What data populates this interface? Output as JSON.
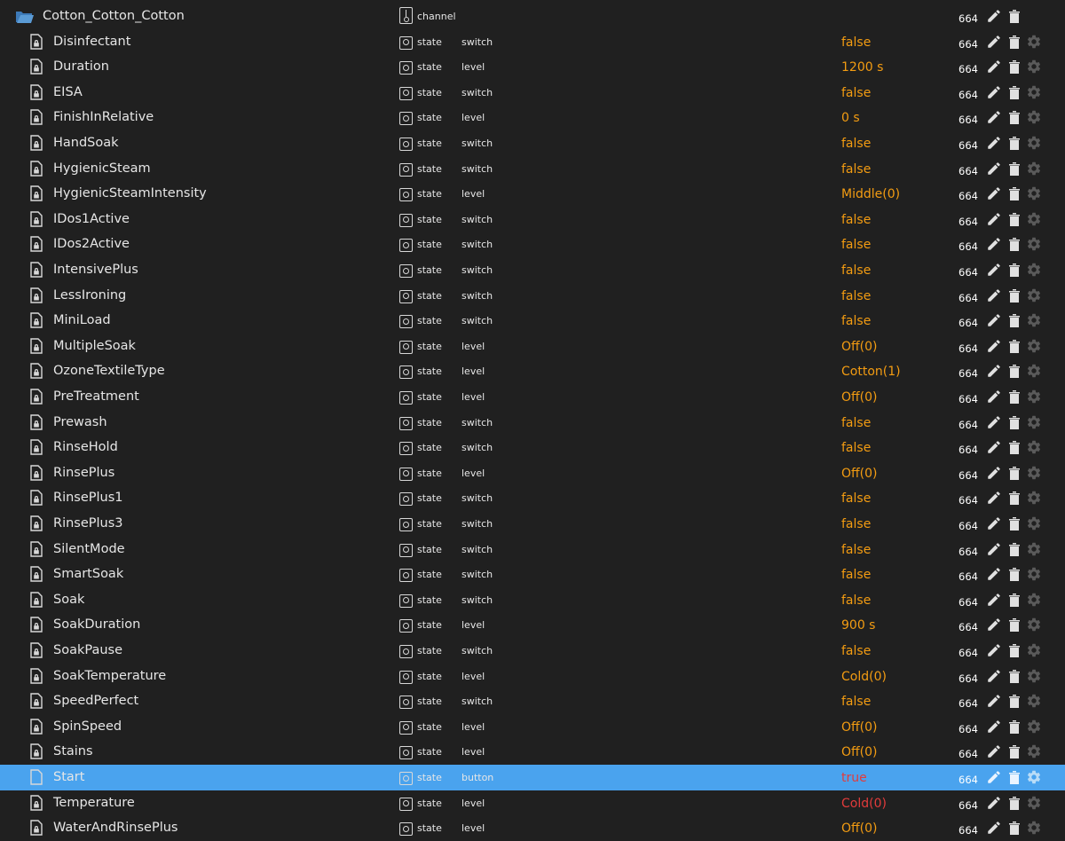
{
  "folder": {
    "name": "Cotton_Cotton_Cotton",
    "type": "channel",
    "acl": "664"
  },
  "rows": [
    {
      "name": "Disinfectant",
      "type": "state",
      "role": "switch",
      "value": "false",
      "acl": "664"
    },
    {
      "name": "Duration",
      "type": "state",
      "role": "level",
      "value": "1200 s",
      "acl": "664"
    },
    {
      "name": "EISA",
      "type": "state",
      "role": "switch",
      "value": "false",
      "acl": "664"
    },
    {
      "name": "FinishInRelative",
      "type": "state",
      "role": "level",
      "value": "0 s",
      "acl": "664"
    },
    {
      "name": "HandSoak",
      "type": "state",
      "role": "switch",
      "value": "false",
      "acl": "664"
    },
    {
      "name": "HygienicSteam",
      "type": "state",
      "role": "switch",
      "value": "false",
      "acl": "664"
    },
    {
      "name": "HygienicSteamIntensity",
      "type": "state",
      "role": "level",
      "value": "Middle(0)",
      "acl": "664"
    },
    {
      "name": "IDos1Active",
      "type": "state",
      "role": "switch",
      "value": "false",
      "acl": "664"
    },
    {
      "name": "IDos2Active",
      "type": "state",
      "role": "switch",
      "value": "false",
      "acl": "664"
    },
    {
      "name": "IntensivePlus",
      "type": "state",
      "role": "switch",
      "value": "false",
      "acl": "664"
    },
    {
      "name": "LessIroning",
      "type": "state",
      "role": "switch",
      "value": "false",
      "acl": "664"
    },
    {
      "name": "MiniLoad",
      "type": "state",
      "role": "switch",
      "value": "false",
      "acl": "664"
    },
    {
      "name": "MultipleSoak",
      "type": "state",
      "role": "level",
      "value": "Off(0)",
      "acl": "664"
    },
    {
      "name": "OzoneTextileType",
      "type": "state",
      "role": "level",
      "value": "Cotton(1)",
      "acl": "664"
    },
    {
      "name": "PreTreatment",
      "type": "state",
      "role": "level",
      "value": "Off(0)",
      "acl": "664"
    },
    {
      "name": "Prewash",
      "type": "state",
      "role": "switch",
      "value": "false",
      "acl": "664"
    },
    {
      "name": "RinseHold",
      "type": "state",
      "role": "switch",
      "value": "false",
      "acl": "664"
    },
    {
      "name": "RinsePlus",
      "type": "state",
      "role": "level",
      "value": "Off(0)",
      "acl": "664"
    },
    {
      "name": "RinsePlus1",
      "type": "state",
      "role": "switch",
      "value": "false",
      "acl": "664"
    },
    {
      "name": "RinsePlus3",
      "type": "state",
      "role": "switch",
      "value": "false",
      "acl": "664"
    },
    {
      "name": "SilentMode",
      "type": "state",
      "role": "switch",
      "value": "false",
      "acl": "664"
    },
    {
      "name": "SmartSoak",
      "type": "state",
      "role": "switch",
      "value": "false",
      "acl": "664"
    },
    {
      "name": "Soak",
      "type": "state",
      "role": "switch",
      "value": "false",
      "acl": "664"
    },
    {
      "name": "SoakDuration",
      "type": "state",
      "role": "level",
      "value": "900 s",
      "acl": "664"
    },
    {
      "name": "SoakPause",
      "type": "state",
      "role": "switch",
      "value": "false",
      "acl": "664"
    },
    {
      "name": "SoakTemperature",
      "type": "state",
      "role": "level",
      "value": "Cold(0)",
      "acl": "664"
    },
    {
      "name": "SpeedPerfect",
      "type": "state",
      "role": "switch",
      "value": "false",
      "acl": "664"
    },
    {
      "name": "SpinSpeed",
      "type": "state",
      "role": "level",
      "value": "Off(0)",
      "acl": "664"
    },
    {
      "name": "Stains",
      "type": "state",
      "role": "level",
      "value": "Off(0)",
      "acl": "664"
    },
    {
      "name": "Start",
      "type": "state",
      "role": "button",
      "value": "true",
      "acl": "664",
      "selected": true,
      "writeonly": true
    },
    {
      "name": "Temperature",
      "type": "state",
      "role": "level",
      "value": "Cold(0)",
      "acl": "664",
      "value_color": "#e23b3b"
    },
    {
      "name": "WaterAndRinsePlus",
      "type": "state",
      "role": "level",
      "value": "Off(0)",
      "acl": "664"
    }
  ],
  "colors": {
    "background": "#202020",
    "selected": "#4aa3ee",
    "value": "#f39c12",
    "value_alert": "#e23b3b"
  }
}
